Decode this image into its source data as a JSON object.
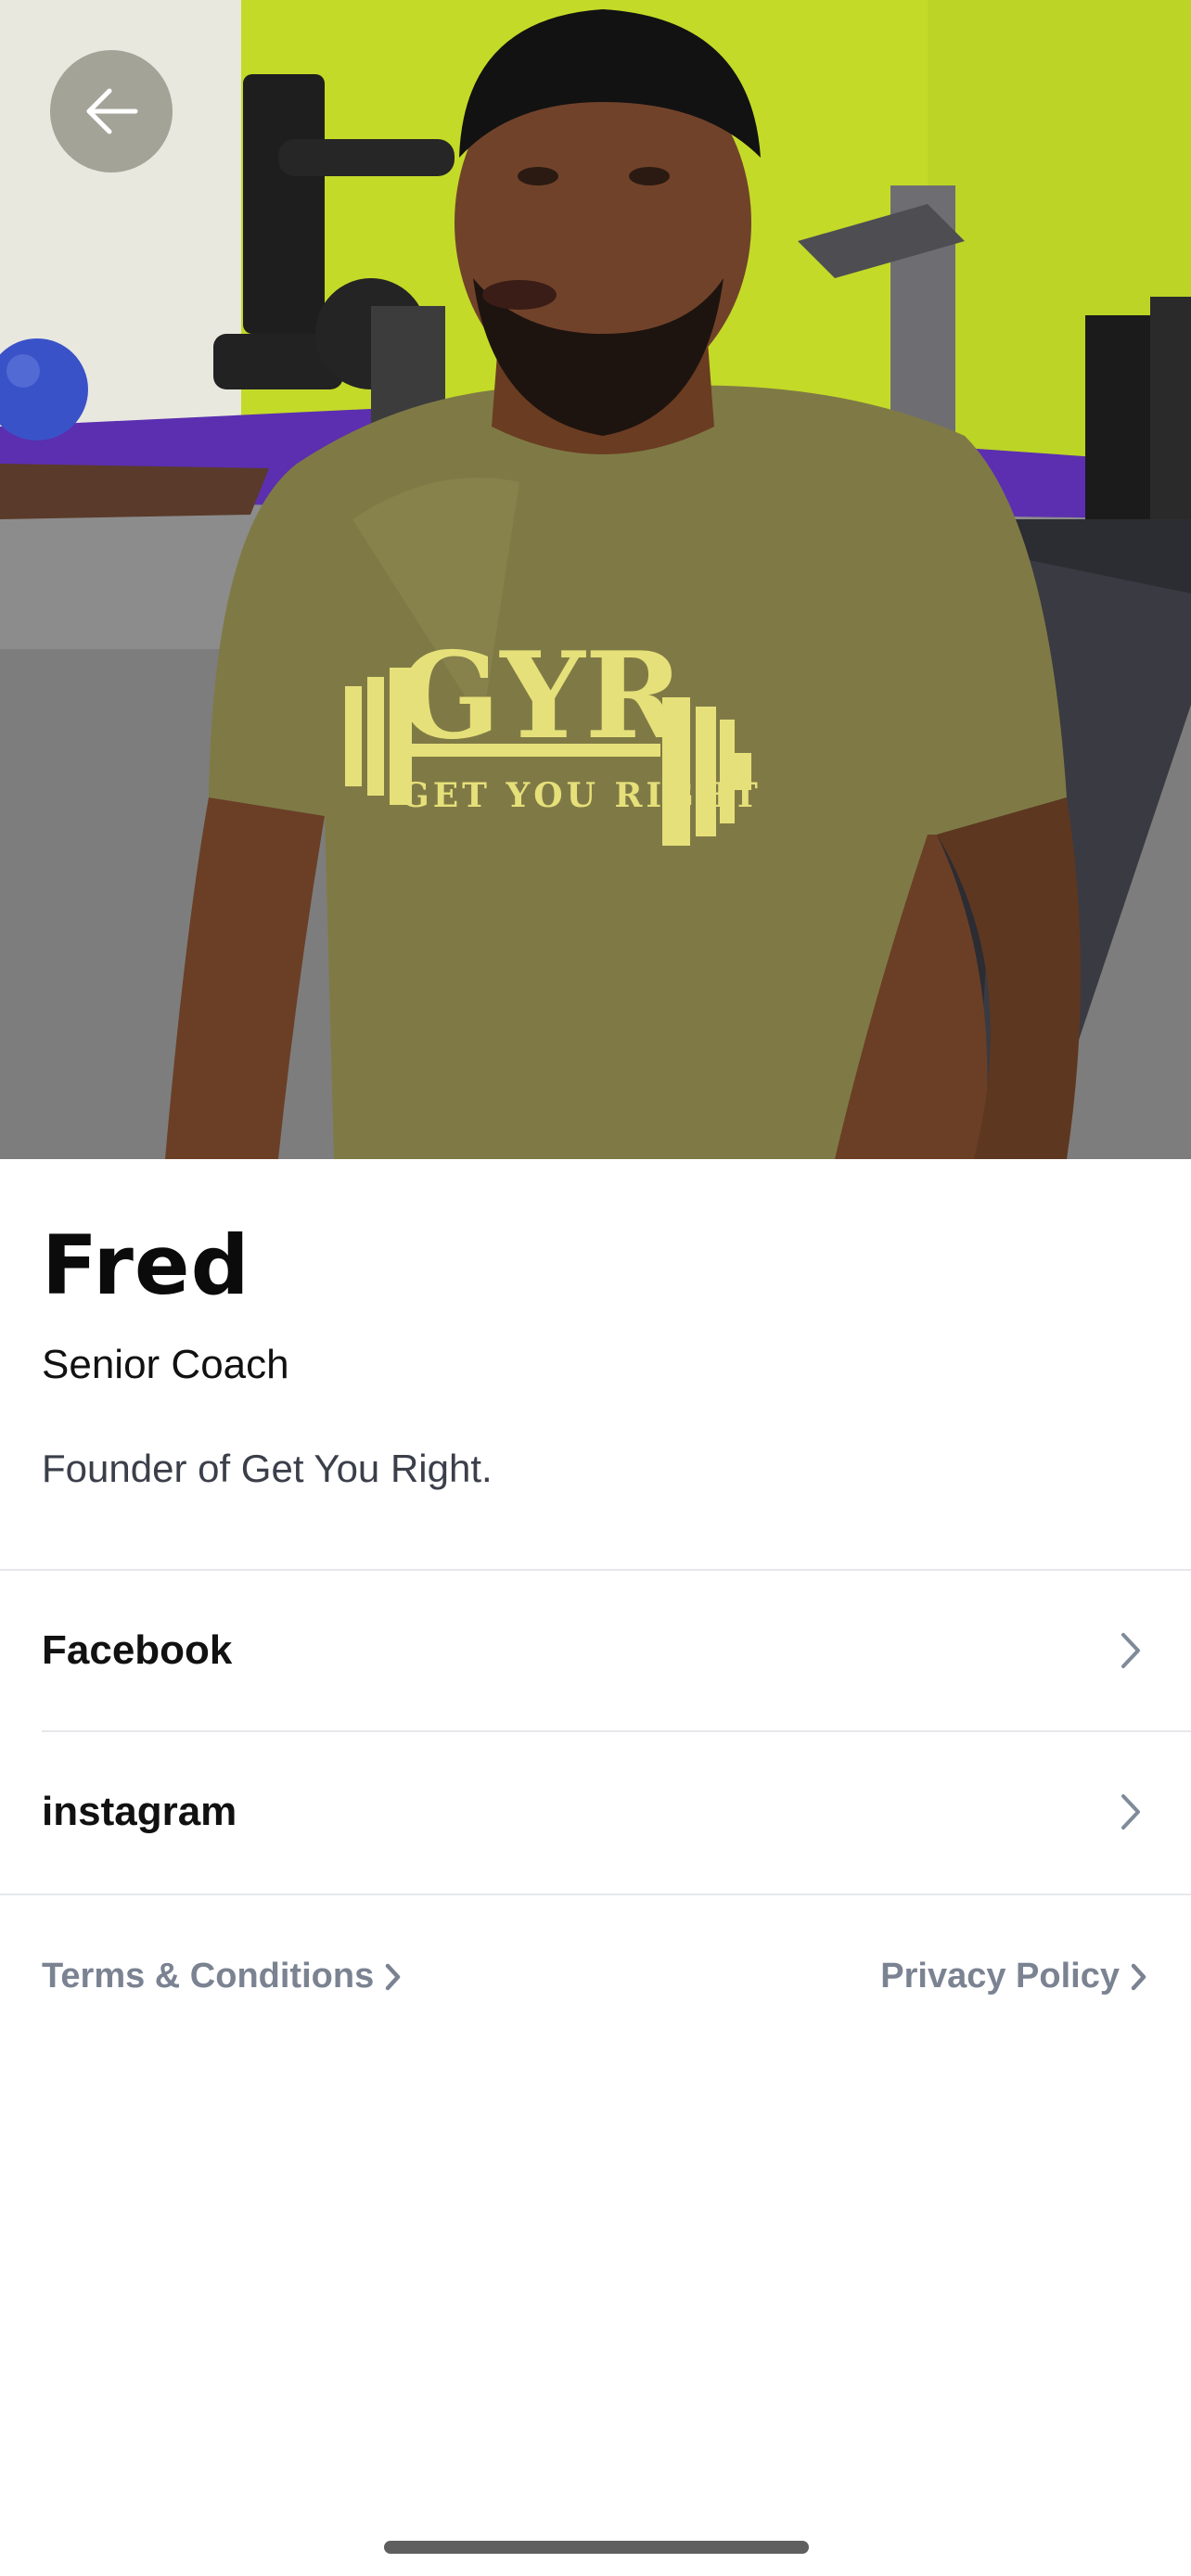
{
  "coach": {
    "name": "Fred",
    "role": "Senior Coach",
    "bio": "Founder of Get You Right.",
    "shirt_logo": "GYR",
    "shirt_tagline": "GET YOU RIGHT"
  },
  "links": [
    {
      "label": "Facebook"
    },
    {
      "label": "instagram"
    }
  ],
  "footer": {
    "terms_label": "Terms & Conditions",
    "privacy_label": "Privacy Policy"
  },
  "icons": {
    "back": "arrow-left-icon",
    "chevron": "chevron-right-icon"
  },
  "colors": {
    "text_primary": "#111111",
    "text_secondary": "#3b3f4a",
    "footer_link": "#7b8392",
    "chevron": "#7f8b99",
    "divider": "#e6e7ea",
    "wall_green": "#c6dc2a",
    "shirt_olive": "#7f7a45",
    "logo_yellow": "#e6e07a"
  }
}
